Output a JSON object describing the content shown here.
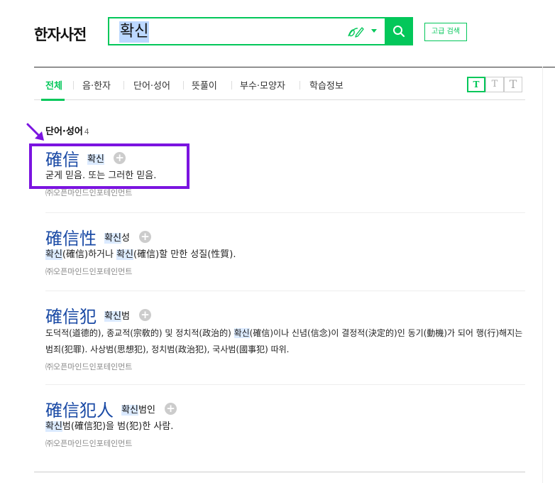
{
  "header": {
    "logo": "한자사전",
    "search_value": "확신",
    "advanced_label": "고급 검색"
  },
  "tabs": [
    {
      "label": "전체"
    },
    {
      "label": "음·한자"
    },
    {
      "label": "단어·성어"
    },
    {
      "label": "뜻풀이"
    },
    {
      "label": "부수·모양자"
    },
    {
      "label": "학습정보"
    }
  ],
  "font_size": {
    "small": "T",
    "medium": "T",
    "large": "T"
  },
  "section": {
    "title": "단어·성어",
    "count": "4"
  },
  "entries": [
    {
      "hanja": "確信",
      "reading_hl": "확신",
      "reading_rest": "",
      "def_parts": [
        "굳게 믿음. 또는 그러한 믿음."
      ],
      "source": "㈜오픈마인드인포테인먼트"
    },
    {
      "hanja": "確信性",
      "reading_hl": "확신",
      "reading_rest": "성",
      "def_hl1": "확신",
      "def_1": "(確信)하거나 ",
      "def_hl2": "확신",
      "def_2": "(確信)할 만한 성질(性質).",
      "source": "㈜오픈마인드인포테인먼트"
    },
    {
      "hanja": "確信犯",
      "reading_hl": "확신",
      "reading_rest": "범",
      "def_pre": "도덕적(道德的), 종교적(宗敎的) 및 정치적(政治的) ",
      "def_hl": "확신",
      "def_post": "(確信)이나 신념(信念)이 결정적(決定的)인 동기(動機)가 되어 행(行)해지는 범죄(犯罪). 사상범(思想犯), 정치범(政治犯), 국사범(國事犯) 따위.",
      "source": "㈜오픈마인드인포테인먼트"
    },
    {
      "hanja": "確信犯人",
      "reading_hl": "확신",
      "reading_rest": "범인",
      "def_hl": "확신",
      "def_post": "범(確信犯)을 범(犯)한 사람.",
      "source": "㈜오픈마인드인포테인먼트"
    }
  ],
  "colors": {
    "accent": "#03c75a",
    "hanja": "#1a4aa5",
    "annotation": "#7b14e0"
  }
}
